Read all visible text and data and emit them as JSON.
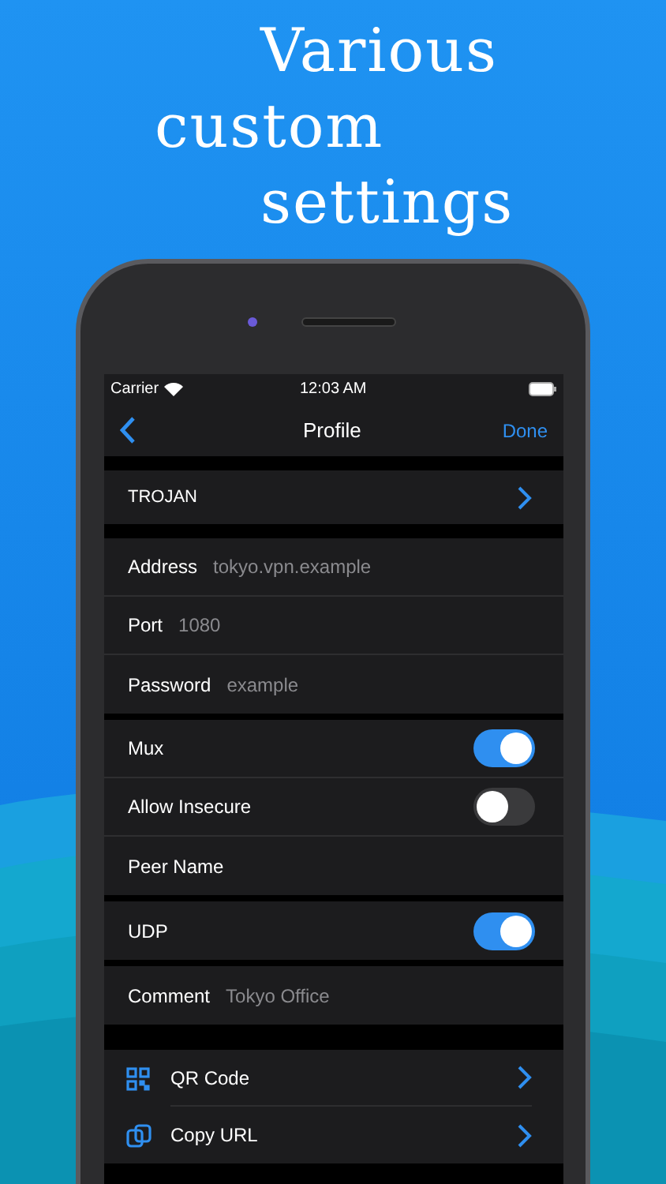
{
  "headline": [
    "Various",
    "custom",
    "settings"
  ],
  "status_bar": {
    "carrier": "Carrier",
    "time": "12:03 AM"
  },
  "nav": {
    "title": "Profile",
    "done": "Done"
  },
  "protocol": {
    "label": "TROJAN"
  },
  "sections": [
    [
      {
        "kind": "field",
        "label": "Address",
        "placeholder": "tokyo.vpn.example"
      },
      {
        "kind": "field",
        "label": "Port",
        "placeholder": "1080"
      },
      {
        "kind": "field",
        "label": "Password",
        "placeholder": "example"
      }
    ],
    [
      {
        "kind": "toggle",
        "label": "Mux",
        "on": true
      },
      {
        "kind": "toggle",
        "label": "Allow Insecure",
        "on": false
      },
      {
        "kind": "field",
        "label": "Peer Name"
      }
    ],
    [
      {
        "kind": "toggle",
        "label": "UDP",
        "on": true
      }
    ],
    [
      {
        "kind": "field",
        "label": "Comment",
        "placeholder": "Tokyo Office"
      }
    ]
  ],
  "actions": [
    {
      "label": "QR Code"
    },
    {
      "label": "Copy URL"
    }
  ]
}
